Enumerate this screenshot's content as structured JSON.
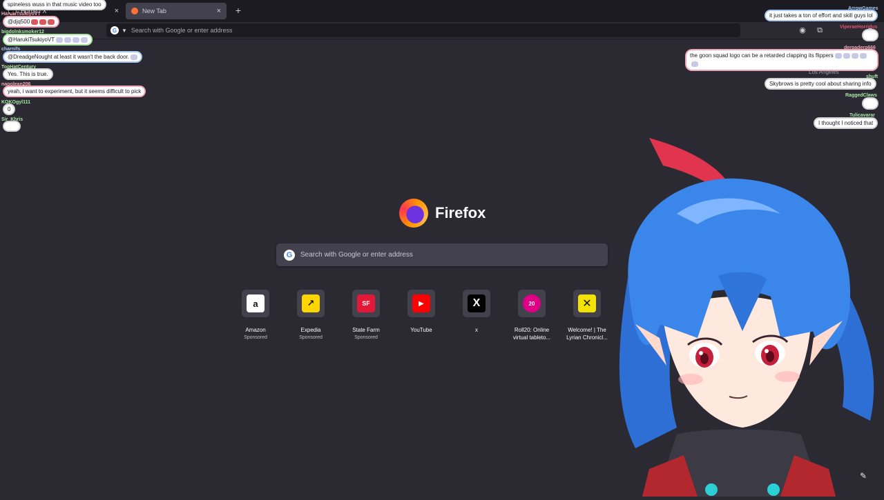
{
  "browser": {
    "tabs": [
      {
        "label": "Home / X"
      },
      {
        "label": "New Tab"
      }
    ],
    "new_tab_symbol": "+",
    "close_symbol": "×",
    "urlbar_placeholder": "Search with Google or enter address",
    "engine_letter": "G"
  },
  "home": {
    "brand": "Firefox",
    "search_placeholder": "Search with Google or enter address",
    "engine_letter": "G",
    "tiles": [
      {
        "title": "Amazon",
        "sub": "Sponsored",
        "glyph": "a",
        "bg": "#ffffff",
        "fg": "#111111"
      },
      {
        "title": "Expedia",
        "sub": "Sponsored",
        "glyph": "↗",
        "bg": "#ffd500",
        "fg": "#111111"
      },
      {
        "title": "State Farm",
        "sub": "Sponsored",
        "glyph": "SF",
        "bg": "#e31837",
        "fg": "#ffffff"
      },
      {
        "title": "YouTube",
        "sub": "",
        "glyph": "▶",
        "bg": "#ff0000",
        "fg": "#ffffff"
      },
      {
        "title": "x",
        "sub": "",
        "glyph": "X",
        "bg": "#000000",
        "fg": "#ffffff"
      },
      {
        "title": "Roll20: Online",
        "title2": "virtual tableto...",
        "sub": "",
        "glyph": "20",
        "bg": "#e10085",
        "fg": "#ffffff"
      },
      {
        "title": "Welcome! | The",
        "title2": "Lyrian Chronicl...",
        "sub": "",
        "glyph": "✕",
        "bg": "#f4e300",
        "fg": "#111111"
      }
    ]
  },
  "chat_left": [
    {
      "user": "",
      "text": "spineless wuss in that music video too",
      "style": "gray"
    },
    {
      "user": "HarukiTsukiyoVT",
      "text": "@djq500",
      "style": "pink"
    },
    {
      "user": "bigdolnksmoker12",
      "text": "@HarukiTsukiyoVT",
      "style": "green"
    },
    {
      "user": "charnifs",
      "text": "@DreadgeNought at least it wasn't the back door.",
      "style": "blue"
    },
    {
      "user": "TopHatCentury",
      "text": "Yes. This is true.",
      "style": "gray"
    },
    {
      "user": "napolean206",
      "text": "yeah, i want to experiment, but it seems difficult to pick",
      "style": "pink"
    },
    {
      "user": "KOKOgyl111",
      "text": "0",
      "style": "gray"
    },
    {
      "user": "Sir_Khris",
      "text": "",
      "style": "gray"
    }
  ],
  "chat_right": [
    {
      "user": "ArrowGames",
      "text": "it just takes a ton of effort and skill guys lol",
      "style": "blue"
    },
    {
      "user": "ViperaeHorridus",
      "text": "",
      "style": "gray"
    },
    {
      "user": "derpaderp666",
      "text": "the goon squad logo can be a retarded clapping its flippers",
      "style": "pink"
    },
    {
      "user": "shuft",
      "text": "Skybrows is pretty cool about sharing info",
      "style": "gray"
    },
    {
      "user": "RaggedClaws",
      "text": "",
      "style": "gray"
    },
    {
      "user": "Tulicavarar",
      "text": "I thought I noticed that",
      "style": "gray"
    }
  ],
  "location_text": "Los Angeles",
  "colors": {
    "bg": "#2b2a33",
    "chrome": "#1c1b22",
    "tile_bg": "#42414d"
  }
}
